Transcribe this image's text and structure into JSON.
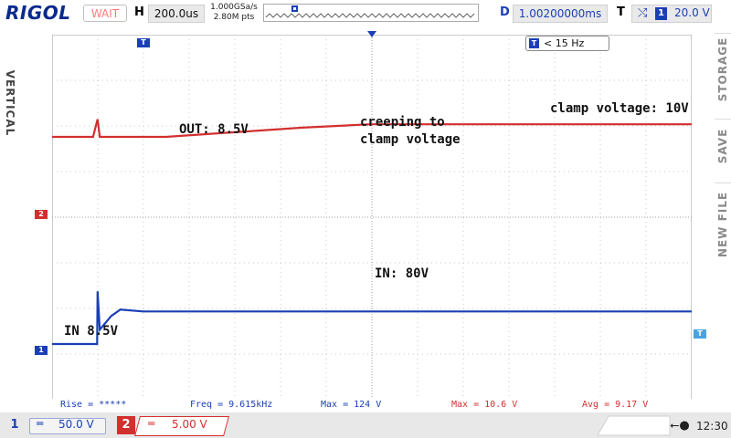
{
  "header": {
    "brand": "RIGOL",
    "run_status": "WAIT",
    "horizontal_label": "H",
    "timebase": "200.0us",
    "sample_rate": "1.000GSa/s",
    "memory_depth": "2.80M pts",
    "delay_label": "D",
    "delay_value": "1.00200000ms",
    "trigger_label": "T",
    "trigger_source": "1",
    "trigger_level": "20.0 V"
  },
  "left_menu": {
    "label": "VERTICAL"
  },
  "right_menu": {
    "items": [
      {
        "label": "STORAGE"
      },
      {
        "label": "SAVE"
      },
      {
        "label": "NEW FILE"
      }
    ]
  },
  "screen": {
    "trigger_marker": "T",
    "ch2_marker": "2",
    "ch1_marker": "1",
    "level_marker": "T",
    "filter_badge_marker": "T",
    "filter_badge_text": "< 15 Hz"
  },
  "annotations": {
    "out": "OUT: 8.5V",
    "creeping_line1": "creeping to",
    "creeping_line2": "clamp voltage",
    "clamp": "clamp voltage: 10V",
    "in_final": "IN: 80V",
    "in_initial": "IN 8.5V"
  },
  "measurements": [
    {
      "text": "Rise = *****",
      "color": "#1a3fb5"
    },
    {
      "text": "Freq = 9.615kHz",
      "color": "#1a3fb5"
    },
    {
      "text": "Max = 124 V",
      "color": "#1a3fb5"
    },
    {
      "text": "Max = 10.6 V",
      "color": "#d32f2f"
    },
    {
      "text": "Avg = 9.17 V",
      "color": "#d32f2f"
    }
  ],
  "channels": [
    {
      "number": "1",
      "coupling": "DC",
      "scale": "50.0 V",
      "color": "#1a3fb5"
    },
    {
      "number": "2",
      "coupling": "DC",
      "scale": "5.00 V",
      "color": "#d32f2f"
    }
  ],
  "status": {
    "clock": "12:30",
    "usb_icon": "usb-icon"
  },
  "colors": {
    "ch1": "#1a3fb5",
    "ch2": "#d32f2f",
    "grid": "#9a9a9a",
    "brand": "#0a2a8c"
  },
  "chart_data": {
    "type": "line",
    "x_label": "",
    "timebase_per_div": "200.0us",
    "series": [
      {
        "name": "",
        "channel": "2",
        "volts_per_div": 5.0,
        "points": [
          [
            0,
            8.5
          ],
          [
            0.9,
            8.5
          ],
          [
            1.0,
            10.6
          ],
          [
            1.05,
            8.5
          ],
          [
            2.5,
            8.5
          ],
          [
            5.5,
            9.6
          ],
          [
            7,
            10.0
          ],
          [
            10,
            10.0
          ]
        ]
      },
      {
        "name": "",
        "channel": "1",
        "volts_per_div": 50.0,
        "points": [
          [
            0,
            8.5
          ],
          [
            0.99,
            8.5
          ],
          [
            1.0,
            124
          ],
          [
            1.05,
            40
          ],
          [
            1.3,
            70
          ],
          [
            1.5,
            84
          ],
          [
            2.0,
            80
          ],
          [
            7,
            80
          ]
        ]
      }
    ]
  }
}
